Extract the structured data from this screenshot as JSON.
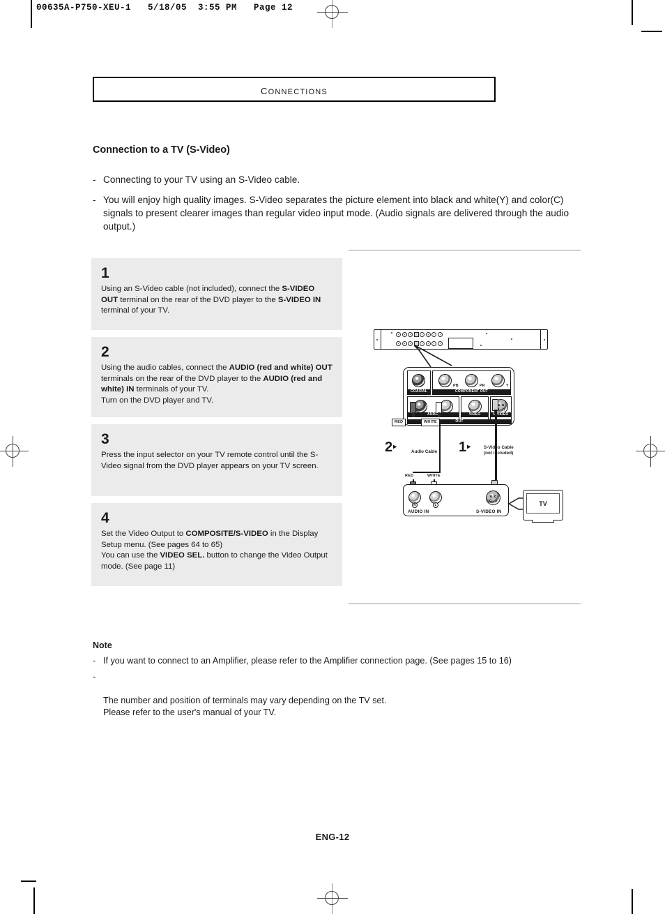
{
  "print_slug": "00635A-P750-XEU-1   5/18/05  3:55 PM   Page 12",
  "chapter": {
    "title": "Connections"
  },
  "section": {
    "title": "Connection to a TV (S-Video)"
  },
  "intro_bullets": [
    "Connecting to your TV using an S-Video cable.",
    "You will enjoy high quality images. S-Video separates the picture element into black and white(Y) and color(C) signals to present clearer images than regular video input mode. (Audio signals are delivered through the audio output.)"
  ],
  "steps": [
    {
      "number": "1",
      "parts": [
        {
          "t": "Using an S-Video cable (not included), connect the ",
          "b": false
        },
        {
          "t": "S-VIDEO OUT",
          "b": true
        },
        {
          "t": " terminal on the rear of the DVD player to the ",
          "b": false
        },
        {
          "t": "S-VIDEO IN",
          "b": true
        },
        {
          "t": " terminal of your TV.",
          "b": false
        }
      ]
    },
    {
      "number": "2",
      "parts": [
        {
          "t": "Using the audio cables, connect the ",
          "b": false
        },
        {
          "t": "AUDIO (red and white) OUT",
          "b": true
        },
        {
          "t": " terminals on the rear of the DVD player to the ",
          "b": false
        },
        {
          "t": "AUDIO (red and white) IN",
          "b": true
        },
        {
          "t": " terminals of your TV.",
          "b": false
        },
        {
          "t": "\nTurn on the DVD player and TV.",
          "b": false
        }
      ]
    },
    {
      "number": "3",
      "parts": [
        {
          "t": "Press the input selector on your TV remote control until the S-Video signal from the DVD player appears on your TV screen.",
          "b": false
        }
      ]
    },
    {
      "number": "4",
      "parts": [
        {
          "t": "Set the Video Output to ",
          "b": false
        },
        {
          "t": "COMPOSITE/S-VIDEO",
          "b": true
        },
        {
          "t": " in the Display Setup menu. (See pages 64 to 65)",
          "b": false
        },
        {
          "t": "\nYou can use the ",
          "b": false
        },
        {
          "t": "VIDEO SEL.",
          "b": true
        },
        {
          "t": " button to change the Video Output mode. (See page 11)",
          "b": false
        }
      ]
    }
  ],
  "figure": {
    "dvd_panel_labels": {
      "coaxial": "COAXIAL",
      "component_out": "COMPONENT OUT",
      "component_pb": "PB",
      "component_pr": "PR",
      "component_y": "Y",
      "audio": "AUDIO",
      "video": "VIDEO",
      "svideo": "S-VIDEO",
      "out": "OUT"
    },
    "dvd_cable_labels": {
      "red": "RED",
      "white": "WHITE"
    },
    "callouts": [
      {
        "marker": "2",
        "arrow": "▸",
        "label": "Audio Cable"
      },
      {
        "marker": "1",
        "arrow": "▸",
        "label": "S-Video Cable\n(not included)"
      }
    ],
    "tv_panel_labels": {
      "red": "RED",
      "white": "WHITE",
      "right": "R",
      "left": "L",
      "audio_in": "AUDIO IN",
      "svideo_in": "S-VIDEO  IN"
    },
    "tv_label": "TV"
  },
  "note": {
    "heading": "Note",
    "bullets": [
      "If you want to connect to an Amplifier, please refer to the Amplifier connection page. (See pages 15 to 16)",
      "The number and position of terminals may vary depending on the TV set.\nPlease refer to the user's manual of your TV."
    ]
  },
  "footer": {
    "page": "ENG-12"
  }
}
